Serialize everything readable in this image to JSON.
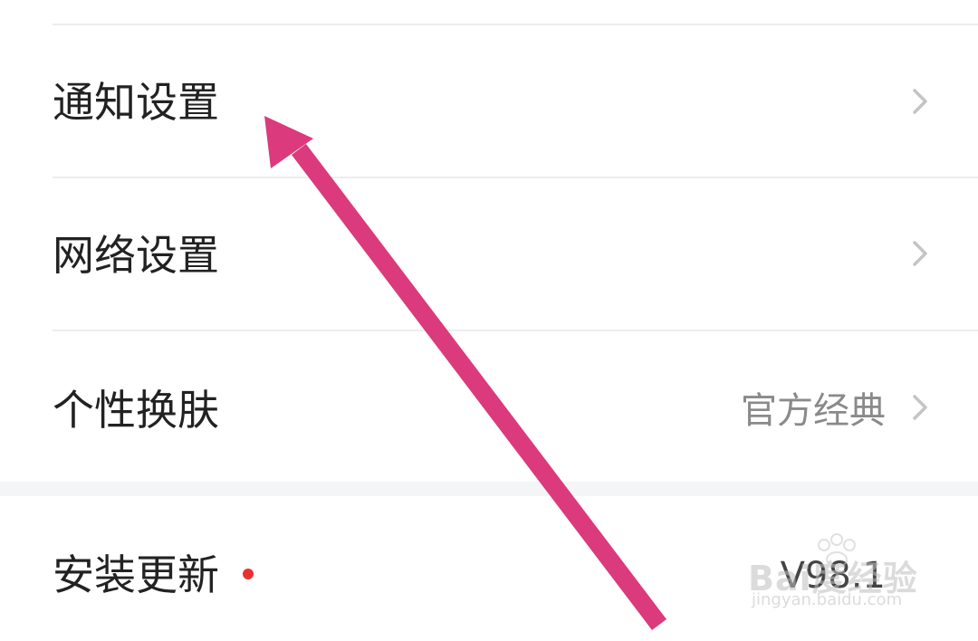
{
  "settings": {
    "rows": [
      {
        "label": "通知设置",
        "value": ""
      },
      {
        "label": "网络设置",
        "value": ""
      },
      {
        "label": "个性换肤",
        "value": "官方经典"
      }
    ],
    "update_row": {
      "label": "安装更新",
      "value": "V98.1"
    }
  },
  "watermark": {
    "brand": "Bai度经验",
    "url": "jingyan.baidu.com"
  },
  "colors": {
    "annotation_arrow": "#db3a7c",
    "update_dot": "#e8312e",
    "section_gap": "#f4f5f7"
  }
}
